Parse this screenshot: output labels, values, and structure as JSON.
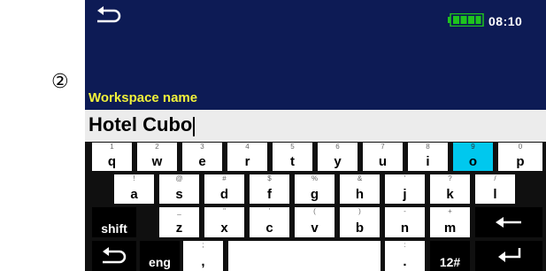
{
  "step_marker": "②",
  "status": {
    "time": "08:10",
    "battery_icon": "battery-full-icon"
  },
  "workspace": {
    "label": "Workspace name",
    "value": "Hotel Cubo"
  },
  "keyboard": {
    "row1": [
      {
        "sub": "1",
        "main": "q"
      },
      {
        "sub": "2",
        "main": "w"
      },
      {
        "sub": "3",
        "main": "e"
      },
      {
        "sub": "4",
        "main": "r"
      },
      {
        "sub": "5",
        "main": "t"
      },
      {
        "sub": "6",
        "main": "y"
      },
      {
        "sub": "7",
        "main": "u"
      },
      {
        "sub": "8",
        "main": "i"
      },
      {
        "sub": "9",
        "main": "o"
      },
      {
        "sub": "0",
        "main": "p"
      }
    ],
    "row2": [
      {
        "sub": "!",
        "main": "a"
      },
      {
        "sub": "@",
        "main": "s"
      },
      {
        "sub": "#",
        "main": "d"
      },
      {
        "sub": "$",
        "main": "f"
      },
      {
        "sub": "%",
        "main": "g"
      },
      {
        "sub": "&",
        "main": "h"
      },
      {
        "sub": "'",
        "main": "j"
      },
      {
        "sub": "?",
        "main": "k"
      },
      {
        "sub": "/",
        "main": "l"
      }
    ],
    "row3": [
      {
        "sub": "_",
        "main": "z"
      },
      {
        "sub": "\"",
        "main": "x"
      },
      {
        "sub": "'",
        "main": "c"
      },
      {
        "sub": "(",
        "main": "v"
      },
      {
        "sub": ")",
        "main": "b"
      },
      {
        "sub": "-",
        "main": "n"
      },
      {
        "sub": "+",
        "main": "m"
      }
    ],
    "shift_label": "shift",
    "lang_label": "eng",
    "comma": {
      "sub": ";",
      "main": ","
    },
    "period": {
      "sub": ":",
      "main": "."
    },
    "symbols_label": "12#",
    "highlight_color": "#00c8ee"
  }
}
